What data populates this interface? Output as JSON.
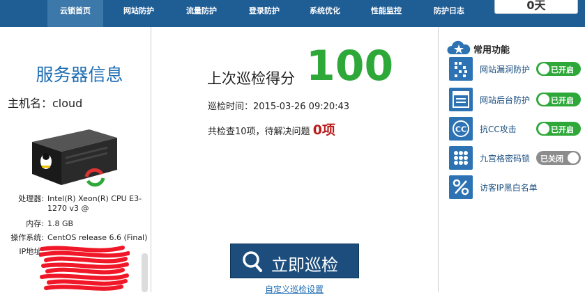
{
  "nav": {
    "items": [
      {
        "label": "云锁首页",
        "active": true
      },
      {
        "label": "网站防护"
      },
      {
        "label": "流量防护"
      },
      {
        "label": "登录防护"
      },
      {
        "label": "系统优化"
      },
      {
        "label": "性能监控"
      },
      {
        "label": "防护日志"
      }
    ],
    "days_value": "0天"
  },
  "server": {
    "title": "服务器信息",
    "hostname": "主机名：cloud",
    "specs": [
      {
        "key": "处理器:",
        "value": "Intel(R) Xeon(R) CPU E3-1270 v3 @"
      },
      {
        "key": "内存:",
        "value": "1.8 GB"
      },
      {
        "key": "操作系统:",
        "value": "CentOS release 6.6 (Final)"
      },
      {
        "key": "IP地址:",
        "value": ""
      }
    ]
  },
  "scan": {
    "score_label": "上次巡检得分",
    "score": "100",
    "time_label": "巡检时间：2015-03-26 09:20:43",
    "summary_prefix": "共检查10项，待解决问题",
    "issue_count": "0项",
    "button_label": "立即巡检",
    "custom_link": "自定义巡检设置"
  },
  "common": {
    "title": "常用功能",
    "features": [
      {
        "label": "网站漏洞防护",
        "icon": "qr-grid-icon",
        "toggle": "已开启",
        "state": "on"
      },
      {
        "label": "网站后台防护",
        "icon": "window-list-icon",
        "toggle": "已开启",
        "state": "on"
      },
      {
        "label": "抗CC攻击",
        "icon": "cc-icon",
        "toggle": "已开启",
        "state": "on"
      },
      {
        "label": "九宫格密码锁",
        "icon": "nine-dots-icon",
        "toggle": "已关闭",
        "state": "off"
      },
      {
        "label": "访客IP黑白名单",
        "icon": "percent-icon"
      }
    ]
  },
  "colors": {
    "nav_bg": "#1f5d95",
    "score_green": "#2fa83a",
    "issue_red": "#b81c1c",
    "button_bg": "#1d4d7d",
    "icon_blue": "#2d73b4"
  }
}
